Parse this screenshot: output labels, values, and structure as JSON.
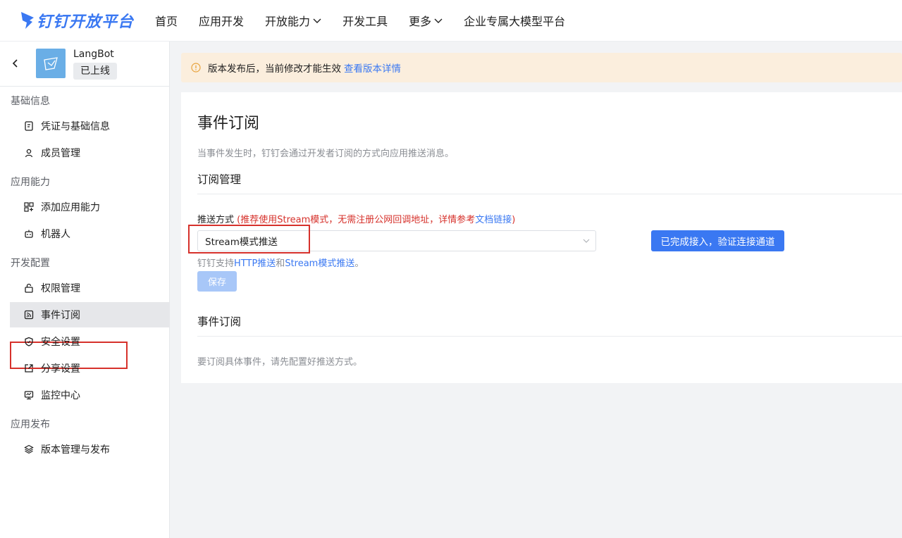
{
  "header": {
    "logo_text": "钉钉开放平台",
    "nav": [
      {
        "label": "首页"
      },
      {
        "label": "应用开发"
      },
      {
        "label": "开放能力"
      },
      {
        "label": "开发工具"
      },
      {
        "label": "更多"
      },
      {
        "label": "企业专属大模型平台"
      }
    ]
  },
  "app": {
    "name": "LangBot",
    "status": "已上线"
  },
  "sidebar": {
    "groups": [
      {
        "label": "基础信息"
      },
      {
        "label": "应用能力"
      },
      {
        "label": "开发配置"
      },
      {
        "label": "应用发布"
      }
    ],
    "items": [
      {
        "label": "凭证与基础信息",
        "icon": "credential-icon"
      },
      {
        "label": "成员管理",
        "icon": "user-icon"
      },
      {
        "label": "添加应用能力",
        "icon": "grid-add-icon"
      },
      {
        "label": "机器人",
        "icon": "robot-icon"
      },
      {
        "label": "权限管理",
        "icon": "lock-icon"
      },
      {
        "label": "事件订阅",
        "icon": "rss-icon"
      },
      {
        "label": "安全设置",
        "icon": "shield-icon"
      },
      {
        "label": "分享设置",
        "icon": "share-icon"
      },
      {
        "label": "监控中心",
        "icon": "monitor-icon"
      },
      {
        "label": "版本管理与发布",
        "icon": "layers-icon"
      }
    ],
    "active_item": "事件订阅"
  },
  "notice": {
    "text": "版本发布后，当前修改才能生效",
    "link": "查看版本详情"
  },
  "main": {
    "title": "事件订阅",
    "description": "当事件发生时，钉钉会通过开发者订阅的方式向应用推送消息。",
    "subscription_section": "订阅管理",
    "push_label": "推送方式",
    "push_hint_prefix": "(推荐使用Stream模式，无需注册公网回调地址，详情参考",
    "push_hint_link": "文档链接",
    "push_hint_suffix": ")",
    "push_mode_value": "Stream模式推送",
    "verify_button": "已完成接入，验证连接通道",
    "support_prefix": "钉钉支持",
    "support_http": "HTTP推送",
    "support_and": "和",
    "support_stream": "Stream模式推送",
    "support_suffix": "。",
    "save_button": "保存",
    "event_section": "事件订阅",
    "event_hint": "要订阅具体事件，请先配置好推送方式。"
  },
  "colors": {
    "accent": "#3a78f2",
    "highlight_box": "#d6312b",
    "notice_bg": "#fbeedd"
  }
}
